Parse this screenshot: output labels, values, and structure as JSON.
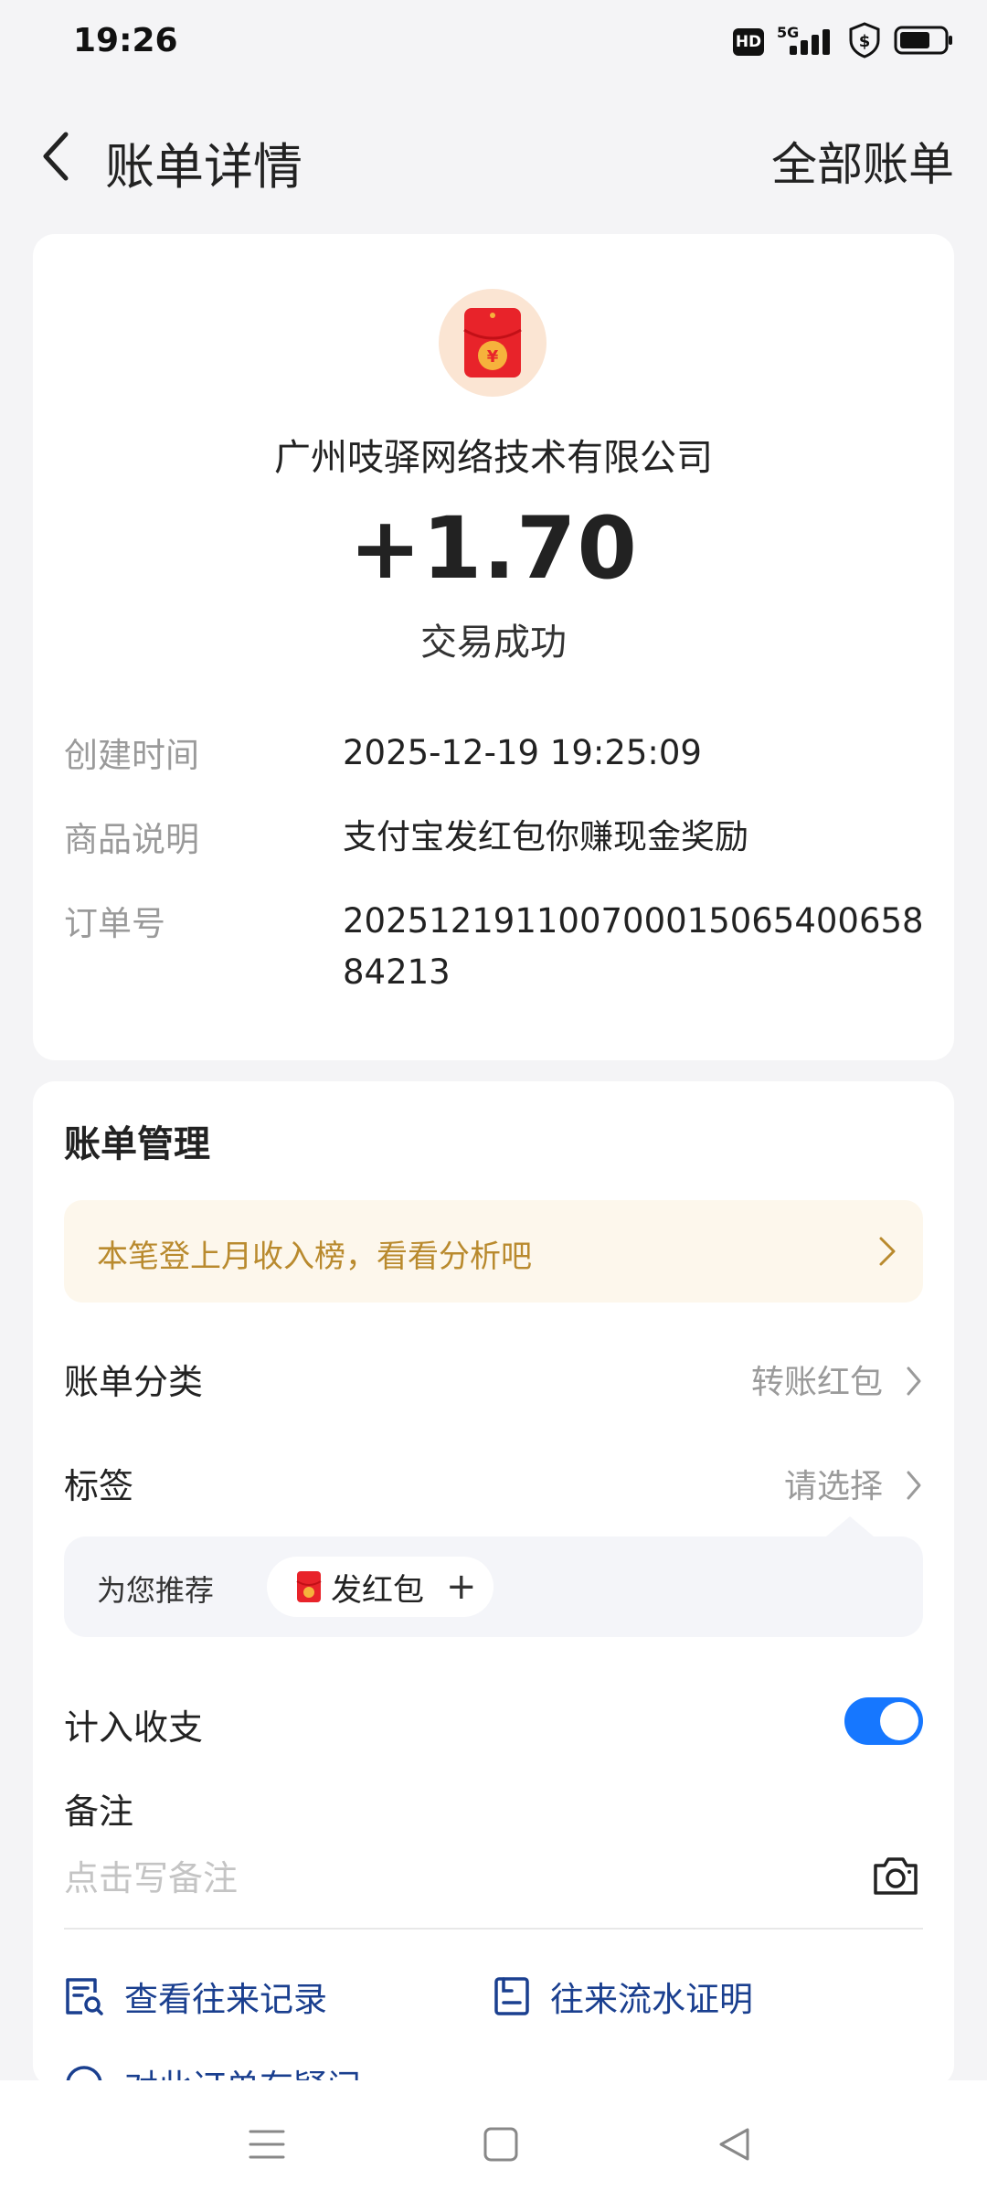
{
  "status_bar": {
    "time": "19:26",
    "hd_label": "HD",
    "network_label": "5G"
  },
  "header": {
    "title": "账单详情",
    "all_bills": "全部账单"
  },
  "transaction": {
    "merchant": "广州吱驿网络技术有限公司",
    "amount": "+1.70",
    "status": "交易成功",
    "details": [
      {
        "label": "创建时间",
        "value": "2025-12-19 19:25:09"
      },
      {
        "label": "商品说明",
        "value": "支付宝发红包你赚现金奖励"
      },
      {
        "label": "订单号",
        "value": "20251219110070001506540065884213"
      }
    ]
  },
  "management": {
    "title": "账单管理",
    "promo": "本笔登上月收入榜，看看分析吧",
    "category_label": "账单分类",
    "category_value": "转账红包",
    "tag_label": "标签",
    "tag_value": "请选择",
    "recommend_label": "为您推荐",
    "recommend_chip": "发红包",
    "include_label": "计入收支",
    "include_enabled": true,
    "note_label": "备注",
    "note_placeholder": "点击写备注",
    "note_value": "",
    "link_history": "查看往来记录",
    "link_statement": "往来流水证明",
    "link_question": "对此订单有疑问"
  },
  "colors": {
    "accent": "#1677ff",
    "link": "#1a3f8f",
    "promo_text": "#b98a2e",
    "promo_bg": "#fdf7ec",
    "red_packet": "#e8232a"
  }
}
